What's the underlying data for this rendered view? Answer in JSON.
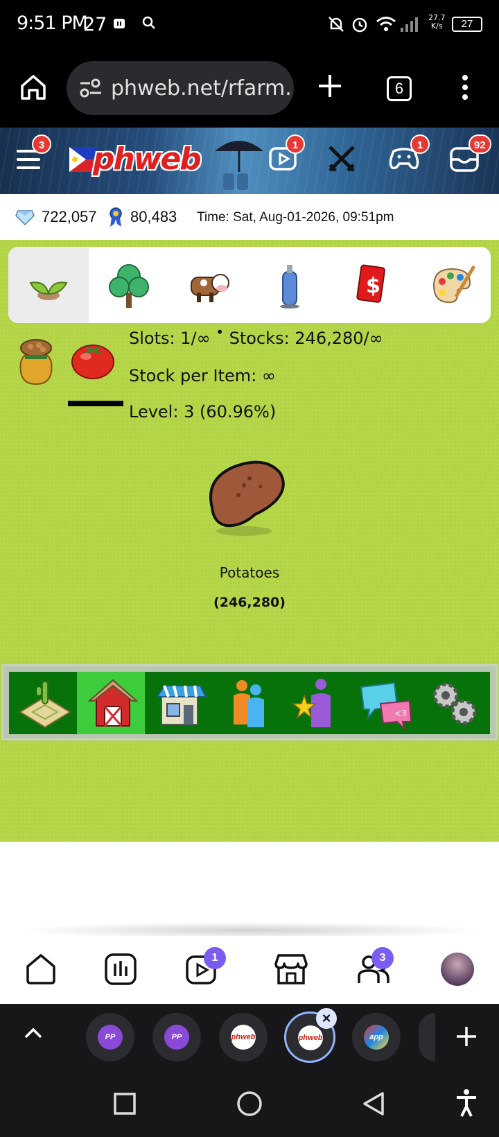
{
  "status_bar": {
    "time": "9:51 PM",
    "date": "27",
    "net_speed_value": "27.7",
    "net_speed_unit": "K/s",
    "battery": "27"
  },
  "browser": {
    "url": "phweb.net/rfarm.",
    "tab_count": "6"
  },
  "site_header": {
    "logo_text": "phweb",
    "menu_badge": "3",
    "video_badge": "1",
    "game_badge": "1",
    "inbox_badge": "92"
  },
  "stats": {
    "diamonds": "722,057",
    "points": "80,483",
    "time": "Time: Sat, Aug-01-2026, 09:51pm"
  },
  "category_tabs": [
    {
      "name": "seeds",
      "icon": "sprout-icon"
    },
    {
      "name": "trees",
      "icon": "tree-icon"
    },
    {
      "name": "animals",
      "icon": "cow-icon"
    },
    {
      "name": "tools",
      "icon": "spray-can-icon"
    },
    {
      "name": "money",
      "icon": "money-icon"
    },
    {
      "name": "decor",
      "icon": "palette-icon"
    }
  ],
  "storage": {
    "slots": "Slots: 1/∞",
    "stocks": "Stocks: 246,280/∞",
    "stock_per_item": "Stock per Item: ∞",
    "level": "Level: 3 (60.96%)"
  },
  "item": {
    "name": "Potatoes",
    "count": "(246,280)"
  },
  "toolbar": [
    {
      "name": "farm",
      "icon": "farm-field-icon"
    },
    {
      "name": "barn",
      "icon": "barn-icon"
    },
    {
      "name": "shop",
      "icon": "shop-icon"
    },
    {
      "name": "neighbors",
      "icon": "people-icon"
    },
    {
      "name": "profile",
      "icon": "star-person-icon"
    },
    {
      "name": "chat",
      "icon": "chat-icon"
    },
    {
      "name": "settings",
      "icon": "gears-icon"
    }
  ],
  "site_nav": {
    "videos_badge": "1",
    "groups_badge": "3"
  },
  "tab_strip": {
    "tabs": [
      "PP",
      "PP",
      "phweb",
      "phweb",
      "app"
    ]
  },
  "colors": {
    "game_bg": "#b6d64a",
    "toolbar_bg": "#07720a",
    "toolbar_active": "#3ccc3c",
    "badge_red": "#e53935",
    "badge_purple": "#7b5cf0"
  }
}
